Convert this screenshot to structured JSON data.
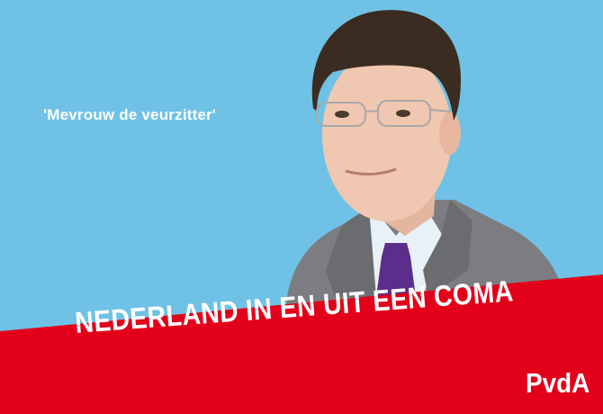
{
  "poster": {
    "quote": "'Mevrouw de veurzitter'",
    "headline": "NEDERLAND IN EN UIT EEN COMA",
    "brand": "PvdA"
  },
  "colors": {
    "background": "#6fc2e6",
    "banner_red": "#e2001a",
    "text": "#ffffff"
  }
}
